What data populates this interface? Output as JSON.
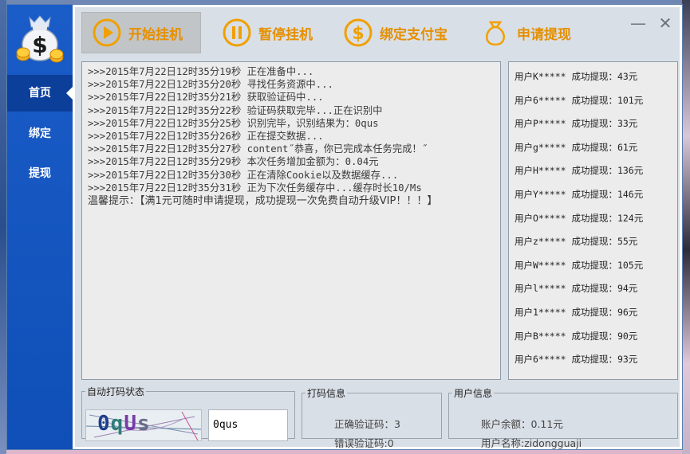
{
  "sidebar": {
    "items": [
      {
        "label": "首页",
        "active": true
      },
      {
        "label": "绑定",
        "active": false
      },
      {
        "label": "提现",
        "active": false
      }
    ]
  },
  "toolbar": {
    "start_label": "开始挂机",
    "pause_label": "暂停挂机",
    "alipay_label": "绑定支付宝",
    "withdraw_label": "申请提现"
  },
  "window": {
    "minimize_glyph": "—",
    "close_glyph": "✕"
  },
  "log": {
    "lines": [
      ">>>2015年7月22日12时35分19秒  正在准备中...",
      ">>>2015年7月22日12时35分20秒  寻找任务资源中...",
      ">>>2015年7月22日12时35分21秒  获取验证码中...",
      ">>>2015年7月22日12时35分22秒  验证码获取完毕...正在识别中",
      ">>>2015年7月22日12时35分25秒  识别完毕，识别结果为：0qus",
      ">>>2015年7月22日12时35分26秒  正在提交数据...",
      ">>>2015年7月22日12时35分27秒  content˝恭喜，你已完成本任务完成！˝",
      ">>>2015年7月22日12时35分29秒  本次任务增加金额为：0.04元",
      ">>>2015年7月22日12时35分30秒  正在清除Cookie以及数据缓存...",
      ">>>2015年7月22日12时35分31秒  正为下次任务缓存中...缓存时长10/Ms"
    ],
    "tip": "温馨提示：【满1元可随时申请提现，成功提现一次免费自动升级VIP！！！】"
  },
  "withdrawals": [
    "用户K***** 成功提现：43元",
    "用户6***** 成功提现：101元",
    "用户P***** 成功提现：33元",
    "用户g***** 成功提现：61元",
    "用户H***** 成功提现：136元",
    "用户Y***** 成功提现：146元",
    "用户O***** 成功提现：124元",
    "用户z***** 成功提现：55元",
    "用户W***** 成功提现：105元",
    "用户l***** 成功提现：94元",
    "用户1***** 成功提现：96元",
    "用户B***** 成功提现：90元",
    "用户6***** 成功提现：93元"
  ],
  "auto_captcha": {
    "legend": "自动打码状态",
    "image_text": "0qUs",
    "recognized": "0qus"
  },
  "dama_info": {
    "legend": "打码信息",
    "correct": "正确验证码：3",
    "wrong": "错误验证码:0"
  },
  "user_info": {
    "legend": "用户信息",
    "balance": "账户余额：0.11元",
    "username": "用户名称:zidongguaji"
  },
  "colors": {
    "sidebar": "#1a5cc8",
    "accent": "#e58f00"
  }
}
